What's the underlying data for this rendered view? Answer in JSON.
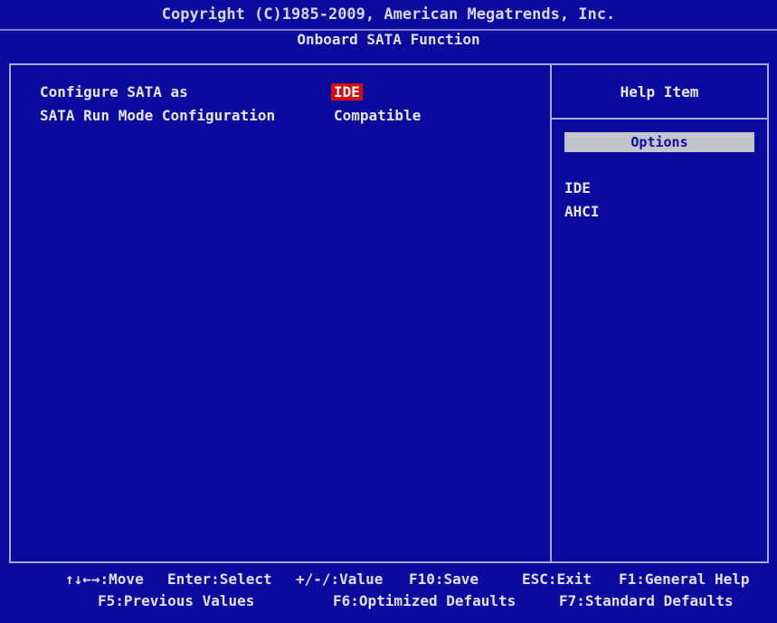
{
  "header": {
    "copyright": "Copyright (C)1985-2009, American Megatrends, Inc.",
    "title": "Onboard SATA Function"
  },
  "settings": [
    {
      "label": "Configure SATA as",
      "value": "IDE"
    },
    {
      "label": "SATA Run Mode Configuration",
      "value": "Compatible"
    }
  ],
  "help": {
    "title": "Help Item",
    "options_heading": "Options",
    "options": [
      "IDE",
      "AHCI"
    ]
  },
  "footer": {
    "move": "↑↓←→:Move",
    "select": "Enter:Select",
    "value": "+/-/:Value",
    "save": "F10:Save",
    "exit": "ESC:Exit",
    "general_help": "F1:General Help",
    "previous": "F5:Previous Values",
    "optimized": "F6:Optimized Defaults",
    "standard": "F7:Standard Defaults"
  },
  "colors": {
    "background": "#0a0a9e",
    "selected": "#d80c0c",
    "options_bar": "#c4c4cc"
  }
}
